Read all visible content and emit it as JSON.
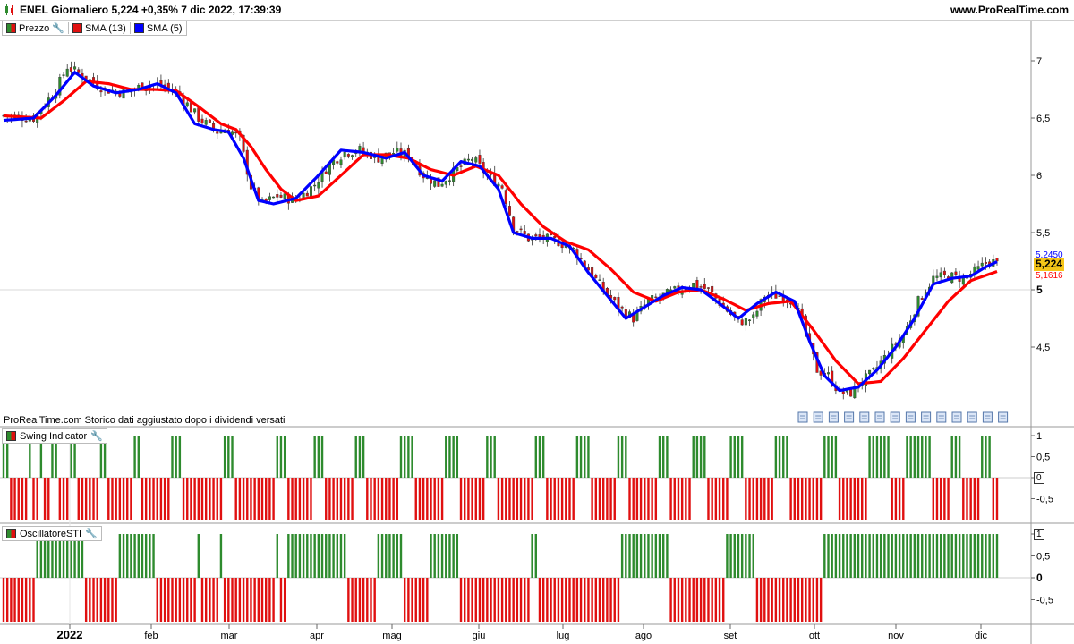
{
  "header": {
    "title": "ENEL Giornaliero 5,224 +0,35% 7 dic 2022, 17:39:39",
    "site": "www.ProRealTime.com"
  },
  "legend_main": [
    {
      "label": "Prezzo",
      "color": "#2e8b2e"
    },
    {
      "label": "SMA (13)",
      "color": "#ff0000"
    },
    {
      "label": "SMA (5)",
      "color": "#0000ff"
    }
  ],
  "note": "ProRealTime.com  Storico dati aggiustato dopo i dividendi versati",
  "price_labels": {
    "sma5": "5,2450",
    "last": "5,224",
    "sma13": "5,1616"
  },
  "panels": {
    "swing": {
      "title": "Swing Indicator",
      "current": "0"
    },
    "sti": {
      "title": "OscillatoreSTI",
      "current": "1"
    }
  },
  "colors": {
    "up": "#2e8b2e",
    "down": "#e01010",
    "sma13": "#ff0000",
    "sma5": "#0000ff",
    "last_bg": "#f5c518"
  },
  "chart_data": [
    {
      "type": "candlestick",
      "title": "ENEL Giornaliero",
      "x_ticks": [
        "2022",
        "feb",
        "mar",
        "apr",
        "mag",
        "giu",
        "lug",
        "ago",
        "set",
        "ott",
        "nov",
        "dic"
      ],
      "y_ticks": [
        "7",
        "6,5",
        "6",
        "5,5",
        "5",
        "4,5"
      ],
      "ylim": [
        4.0,
        7.25
      ],
      "series_names": [
        "Prezzo",
        "SMA (13)",
        "SMA (5)"
      ],
      "close_keypoints": [
        [
          0,
          6.52
        ],
        [
          8,
          6.5
        ],
        [
          14,
          6.75
        ],
        [
          17,
          6.95
        ],
        [
          22,
          6.85
        ],
        [
          27,
          6.75
        ],
        [
          33,
          6.72
        ],
        [
          38,
          6.8
        ],
        [
          43,
          6.78
        ],
        [
          47,
          6.7
        ],
        [
          52,
          6.5
        ],
        [
          57,
          6.38
        ],
        [
          60,
          6.4
        ],
        [
          63,
          6.32
        ],
        [
          66,
          5.9
        ],
        [
          69,
          5.75
        ],
        [
          73,
          5.82
        ],
        [
          78,
          5.78
        ],
        [
          83,
          5.92
        ],
        [
          87,
          6.1
        ],
        [
          91,
          6.2
        ],
        [
          95,
          6.22
        ],
        [
          100,
          6.15
        ],
        [
          104,
          6.2
        ],
        [
          108,
          6.18
        ],
        [
          112,
          6.0
        ],
        [
          116,
          5.92
        ],
        [
          121,
          6.05
        ],
        [
          125,
          6.15
        ],
        [
          129,
          6.0
        ],
        [
          133,
          5.9
        ],
        [
          136,
          5.55
        ],
        [
          140,
          5.45
        ],
        [
          144,
          5.45
        ],
        [
          148,
          5.42
        ],
        [
          152,
          5.35
        ],
        [
          156,
          5.18
        ],
        [
          160,
          5.0
        ],
        [
          164,
          4.85
        ],
        [
          168,
          4.75
        ],
        [
          172,
          4.9
        ],
        [
          176,
          4.95
        ],
        [
          180,
          5.0
        ],
        [
          184,
          5.05
        ],
        [
          188,
          5.0
        ],
        [
          192,
          4.85
        ],
        [
          196,
          4.72
        ],
        [
          200,
          4.75
        ],
        [
          203,
          4.95
        ],
        [
          207,
          4.95
        ],
        [
          211,
          4.9
        ],
        [
          214,
          4.62
        ],
        [
          217,
          4.3
        ],
        [
          220,
          4.25
        ],
        [
          223,
          4.1
        ],
        [
          226,
          4.1
        ],
        [
          229,
          4.2
        ],
        [
          232,
          4.28
        ],
        [
          236,
          4.45
        ],
        [
          240,
          4.6
        ],
        [
          244,
          4.9
        ],
        [
          248,
          5.1
        ],
        [
          252,
          5.12
        ],
        [
          256,
          5.1
        ],
        [
          260,
          5.18
        ],
        [
          263,
          5.26
        ],
        [
          265,
          5.224
        ]
      ],
      "sma13_keypoints": [
        [
          0,
          6.52
        ],
        [
          10,
          6.5
        ],
        [
          16,
          6.65
        ],
        [
          22,
          6.82
        ],
        [
          28,
          6.8
        ],
        [
          34,
          6.75
        ],
        [
          40,
          6.75
        ],
        [
          46,
          6.74
        ],
        [
          52,
          6.6
        ],
        [
          58,
          6.45
        ],
        [
          62,
          6.4
        ],
        [
          66,
          6.25
        ],
        [
          70,
          6.05
        ],
        [
          74,
          5.88
        ],
        [
          78,
          5.78
        ],
        [
          84,
          5.82
        ],
        [
          90,
          6.0
        ],
        [
          96,
          6.18
        ],
        [
          102,
          6.18
        ],
        [
          108,
          6.15
        ],
        [
          114,
          6.05
        ],
        [
          120,
          6.0
        ],
        [
          126,
          6.08
        ],
        [
          132,
          6.0
        ],
        [
          138,
          5.75
        ],
        [
          144,
          5.55
        ],
        [
          150,
          5.42
        ],
        [
          156,
          5.35
        ],
        [
          162,
          5.18
        ],
        [
          168,
          4.98
        ],
        [
          174,
          4.9
        ],
        [
          180,
          4.98
        ],
        [
          186,
          5.0
        ],
        [
          192,
          4.92
        ],
        [
          198,
          4.82
        ],
        [
          204,
          4.88
        ],
        [
          210,
          4.9
        ],
        [
          216,
          4.65
        ],
        [
          222,
          4.38
        ],
        [
          228,
          4.18
        ],
        [
          234,
          4.2
        ],
        [
          240,
          4.4
        ],
        [
          246,
          4.65
        ],
        [
          252,
          4.9
        ],
        [
          258,
          5.08
        ],
        [
          265,
          5.16
        ]
      ],
      "sma5_keypoints": [
        [
          0,
          6.48
        ],
        [
          8,
          6.5
        ],
        [
          14,
          6.7
        ],
        [
          19,
          6.9
        ],
        [
          24,
          6.78
        ],
        [
          30,
          6.72
        ],
        [
          36,
          6.75
        ],
        [
          41,
          6.8
        ],
        [
          46,
          6.72
        ],
        [
          51,
          6.45
        ],
        [
          56,
          6.4
        ],
        [
          60,
          6.38
        ],
        [
          64,
          6.15
        ],
        [
          68,
          5.78
        ],
        [
          72,
          5.75
        ],
        [
          78,
          5.8
        ],
        [
          84,
          6.0
        ],
        [
          90,
          6.22
        ],
        [
          96,
          6.2
        ],
        [
          102,
          6.15
        ],
        [
          107,
          6.2
        ],
        [
          112,
          6.0
        ],
        [
          117,
          5.95
        ],
        [
          122,
          6.12
        ],
        [
          127,
          6.08
        ],
        [
          132,
          5.88
        ],
        [
          136,
          5.5
        ],
        [
          141,
          5.45
        ],
        [
          146,
          5.45
        ],
        [
          151,
          5.38
        ],
        [
          156,
          5.15
        ],
        [
          161,
          4.95
        ],
        [
          166,
          4.75
        ],
        [
          171,
          4.85
        ],
        [
          176,
          4.95
        ],
        [
          181,
          5.02
        ],
        [
          186,
          5.0
        ],
        [
          191,
          4.88
        ],
        [
          196,
          4.75
        ],
        [
          201,
          4.88
        ],
        [
          206,
          4.98
        ],
        [
          211,
          4.9
        ],
        [
          215,
          4.55
        ],
        [
          219,
          4.25
        ],
        [
          223,
          4.12
        ],
        [
          228,
          4.15
        ],
        [
          233,
          4.3
        ],
        [
          238,
          4.5
        ],
        [
          243,
          4.75
        ],
        [
          248,
          5.05
        ],
        [
          253,
          5.1
        ],
        [
          258,
          5.12
        ],
        [
          262,
          5.2
        ],
        [
          265,
          5.245
        ]
      ]
    },
    {
      "type": "bar",
      "title": "Swing Indicator",
      "y_ticks": [
        "1",
        "0,5",
        "0",
        "-0,5"
      ],
      "ylim": [
        -1,
        1
      ],
      "segments": [
        [
          0,
          1,
          1
        ],
        [
          2,
          6,
          -1
        ],
        [
          7,
          7,
          1
        ],
        [
          8,
          9,
          -1
        ],
        [
          10,
          10,
          1
        ],
        [
          11,
          12,
          -1
        ],
        [
          13,
          14,
          1
        ],
        [
          15,
          17,
          -1
        ],
        [
          18,
          19,
          1
        ],
        [
          20,
          25,
          -1
        ],
        [
          26,
          27,
          1
        ],
        [
          28,
          34,
          -1
        ],
        [
          35,
          36,
          1
        ],
        [
          37,
          44,
          -1
        ],
        [
          45,
          47,
          1
        ],
        [
          48,
          58,
          -1
        ],
        [
          59,
          61,
          1
        ],
        [
          62,
          72,
          -1
        ],
        [
          73,
          75,
          1
        ],
        [
          76,
          82,
          -1
        ],
        [
          83,
          85,
          1
        ],
        [
          86,
          93,
          -1
        ],
        [
          94,
          96,
          1
        ],
        [
          97,
          105,
          -1
        ],
        [
          106,
          109,
          1
        ],
        [
          110,
          117,
          -1
        ],
        [
          118,
          121,
          1
        ],
        [
          122,
          128,
          -1
        ],
        [
          129,
          131,
          1
        ],
        [
          132,
          141,
          -1
        ],
        [
          142,
          144,
          1
        ],
        [
          145,
          152,
          -1
        ],
        [
          153,
          156,
          1
        ],
        [
          157,
          163,
          -1
        ],
        [
          164,
          166,
          1
        ],
        [
          167,
          174,
          -1
        ],
        [
          175,
          177,
          1
        ],
        [
          178,
          183,
          -1
        ],
        [
          184,
          187,
          1
        ],
        [
          188,
          193,
          -1
        ],
        [
          194,
          197,
          1
        ],
        [
          198,
          205,
          -1
        ],
        [
          206,
          209,
          1
        ],
        [
          210,
          218,
          -1
        ],
        [
          219,
          222,
          1
        ],
        [
          223,
          230,
          -1
        ],
        [
          231,
          236,
          1
        ],
        [
          237,
          240,
          -1
        ],
        [
          241,
          247,
          1
        ],
        [
          248,
          252,
          -1
        ],
        [
          253,
          255,
          1
        ],
        [
          256,
          260,
          -1
        ],
        [
          261,
          263,
          1
        ],
        [
          264,
          265,
          -1
        ]
      ]
    },
    {
      "type": "bar",
      "title": "OscillatoreSTI",
      "y_ticks": [
        "1",
        "0,5",
        "0",
        "-0,5"
      ],
      "ylim": [
        -1,
        1
      ],
      "segments": [
        [
          0,
          8,
          -1
        ],
        [
          9,
          21,
          1
        ],
        [
          22,
          30,
          -1
        ],
        [
          31,
          40,
          1
        ],
        [
          41,
          51,
          -1
        ],
        [
          52,
          52,
          1
        ],
        [
          53,
          57,
          -1
        ],
        [
          58,
          58,
          1
        ],
        [
          59,
          72,
          -1
        ],
        [
          73,
          73,
          1
        ],
        [
          74,
          75,
          -1
        ],
        [
          76,
          91,
          1
        ],
        [
          92,
          99,
          -1
        ],
        [
          100,
          106,
          1
        ],
        [
          107,
          113,
          -1
        ],
        [
          114,
          121,
          1
        ],
        [
          122,
          140,
          -1
        ],
        [
          141,
          142,
          1
        ],
        [
          143,
          164,
          -1
        ],
        [
          165,
          177,
          1
        ],
        [
          178,
          192,
          -1
        ],
        [
          193,
          200,
          1
        ],
        [
          201,
          218,
          -1
        ],
        [
          219,
          265,
          1
        ]
      ]
    }
  ]
}
